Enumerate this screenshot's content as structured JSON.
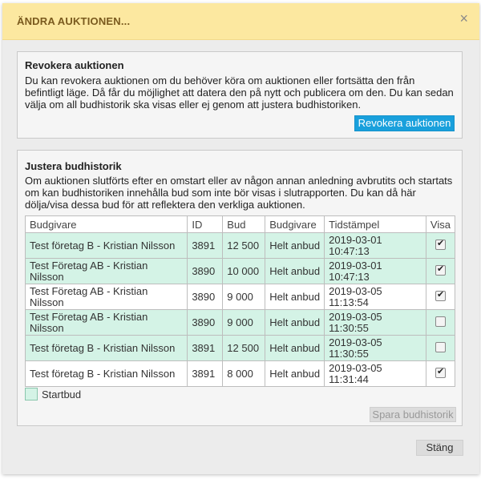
{
  "dialog": {
    "title": "ÄNDRA AUKTIONEN...",
    "close_icon": "×"
  },
  "revoke": {
    "title": "Revokera auktionen",
    "text": "Du kan revokera auktionen om du behöver köra om auktionen eller fortsätta den från befintligt läge. Då får du möjlighet att datera den på nytt och publicera om den. Du kan sedan välja om all budhistorik ska visas eller ej genom att justera budhistoriken.",
    "button_label": "Revokera auktionen",
    "button_color": "#19a0dc"
  },
  "history": {
    "title": "Justera budhistorik",
    "text": "Om auktionen slutförts efter en omstart eller av någon annan anledning avbrutits och startats om kan budhistoriken innehålla bud som inte bör visas i slutrapporten. Du kan då här dölja/visa dessa bud för att reflektera den verkliga auktionen.",
    "columns": [
      "Budgivare",
      "ID",
      "Bud",
      "Budgivare",
      "Tidstämpel",
      "Visa"
    ],
    "rows": [
      {
        "bidder": "Test företag B - Kristian Nilsson",
        "id": "3891",
        "bid": "12 500",
        "type": "Helt anbud",
        "date": "2019-03-01",
        "time": "10:47:13",
        "show": true,
        "start_bid": true
      },
      {
        "bidder": "Test Företag AB - Kristian Nilsson",
        "id": "3890",
        "bid": "10 000",
        "type": "Helt anbud",
        "date": "2019-03-01",
        "time": "10:47:13",
        "show": true,
        "start_bid": true
      },
      {
        "bidder": "Test Företag AB - Kristian Nilsson",
        "id": "3890",
        "bid": "9 000",
        "type": "Helt anbud",
        "date": "2019-03-05",
        "time": "11:13:54",
        "show": true,
        "start_bid": false
      },
      {
        "bidder": "Test Företag AB - Kristian Nilsson",
        "id": "3890",
        "bid": "9 000",
        "type": "Helt anbud",
        "date": "2019-03-05",
        "time": "11:30:55",
        "show": false,
        "start_bid": true
      },
      {
        "bidder": "Test företag B - Kristian Nilsson",
        "id": "3891",
        "bid": "12 500",
        "type": "Helt anbud",
        "date": "2019-03-05",
        "time": "11:30:55",
        "show": false,
        "start_bid": true
      },
      {
        "bidder": "Test företag B - Kristian Nilsson",
        "id": "3891",
        "bid": "8 000",
        "type": "Helt anbud",
        "date": "2019-03-05",
        "time": "11:31:44",
        "show": true,
        "start_bid": false
      }
    ],
    "legend_label": "Startbud",
    "legend_color": "#d4f3e6",
    "save_label": "Spara budhistorik"
  },
  "footer": {
    "close_label": "Stäng"
  }
}
